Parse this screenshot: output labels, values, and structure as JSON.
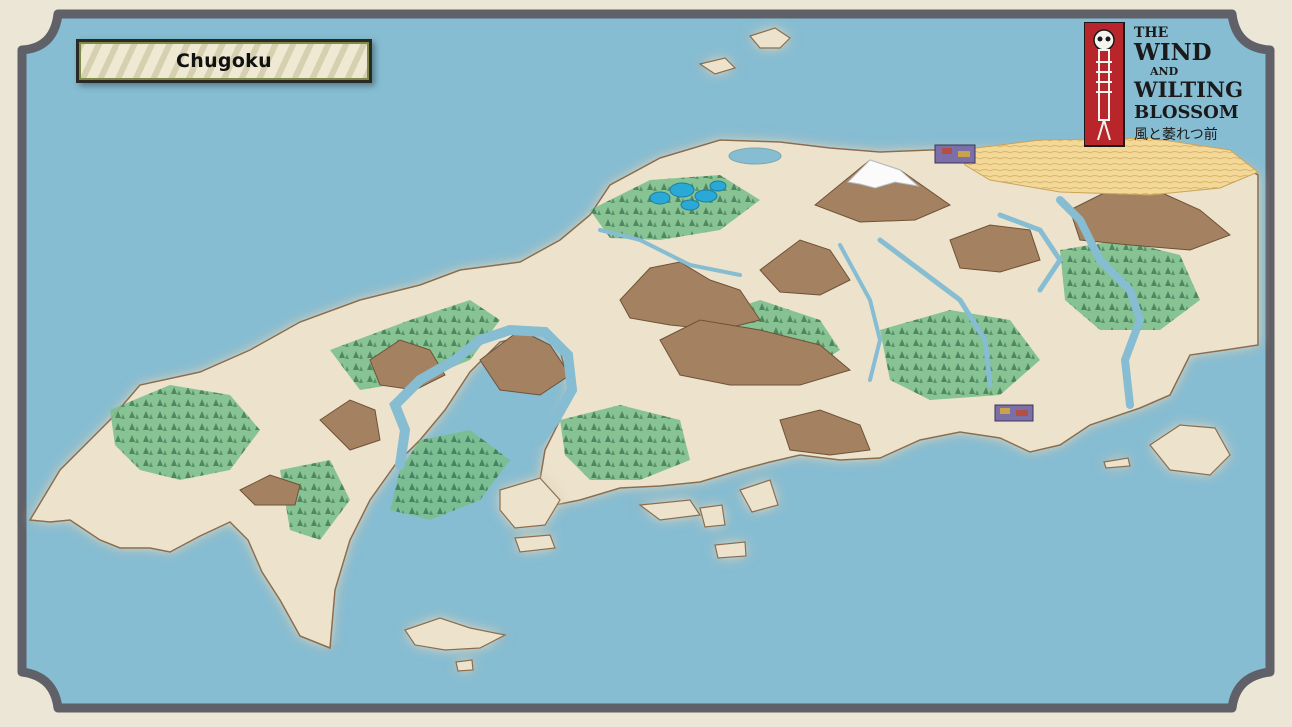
{
  "map": {
    "region_label": "Chugoku"
  },
  "logo": {
    "line1": "THE",
    "line2": "WIND",
    "line3": "AND",
    "line4": "WILTING",
    "line5": "BLOSSOM",
    "subtitle": "風と萎れつ前"
  },
  "colors": {
    "sea": "#86bdd3",
    "land": "#ede3cc",
    "forest": "#6eaf7e",
    "mountain": "#9c7d5f",
    "frame": "#5f6068",
    "banner_border": "#2a2a22",
    "logo_red": "#b8262c"
  }
}
